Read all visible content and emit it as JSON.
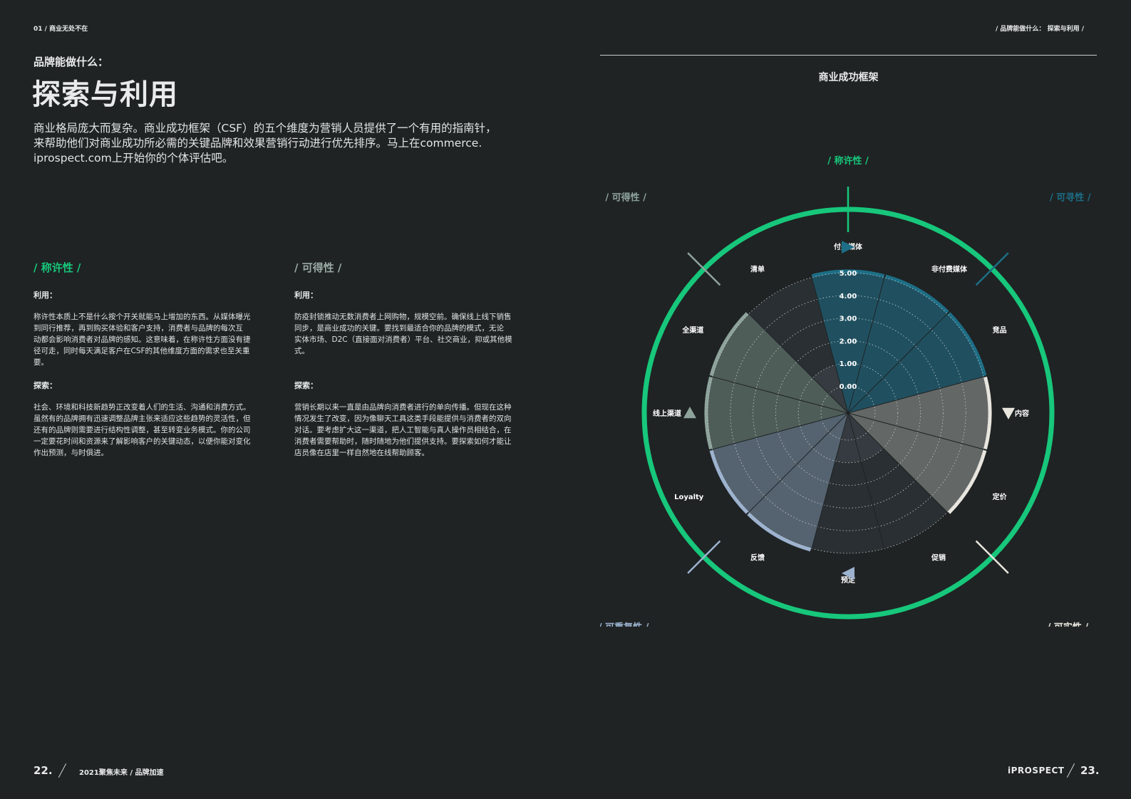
{
  "header": {
    "left": "01 / 商业无处不在",
    "right": "/ 品牌能做什么： 探索与利用 /"
  },
  "title": {
    "kicker": "品牌能做什么：",
    "main": "探索与利用"
  },
  "intro": {
    "line1": "商业格局庞大而复杂。商业成功框架（CSF）的五个维度为营销人员提供了一个有用的指南针，",
    "line2": "来帮助他们对商业成功所必需的关键品牌和效果营销行动进行优先排序。马上在commerce.",
    "line3": "iprospect.com上开始你的个体评估吧。"
  },
  "columns": [
    {
      "heading": "/ 称许性 /",
      "heading_color": "#17c77b",
      "use_label": "利用：",
      "use_lines": [
        "称许性本质上不是什么按个开关就能马上增加的东西。从媒体曝光",
        "到同行推荐，再到购买体验和客户支持，消费者与品牌的每次互",
        "动都会影响消费者对品牌的感知。这意味着，在称许性方面没有捷",
        "径可走，同时每天满足客户在CSF的其他维度方面的需求也至关重",
        "要。"
      ],
      "explore_label": "探索：",
      "explore_lines": [
        "社会、环境和科技新趋势正改变着人们的生活、沟通和消费方式。",
        "虽然有的品牌拥有迅速调整品牌主张来适应这些趋势的灵活性，但",
        "还有的品牌则需要进行结构性调整，甚至转变业务模式。你的公司",
        "一定要花时间和资源来了解影响客户的关键动态，以便你能对变化",
        "作出预测，与时俱进。"
      ]
    },
    {
      "heading": "/ 可得性 /",
      "heading_color": "#9aa9a3",
      "use_label": "利用：",
      "use_lines": [
        "防疫封锁推动无数消费者上网购物，规模空前。确保线上线下销售",
        "同步，是商业成功的关键。要找到最适合你的品牌的模式，无论",
        "实体市场、D2C（直接面对消费者）平台、社交商业，抑或其他模",
        "式。"
      ],
      "explore_label": "探索：",
      "explore_lines": [
        "营销长期以来一直是由品牌向消费者进行的单向传播。但现在这种",
        "情况发生了改变，因为像聊天工具这类手段能提供与消费者的双向",
        "对话。要考虑扩大这一渠道，把人工智能与真人操作员相结合，在",
        "消费者需要帮助时，随时随地为他们提供支持。要探索如何才能让",
        "店员像在店里一样自然地在线帮助顾客。"
      ]
    }
  ],
  "chart_data": {
    "type": "radial-bar",
    "title": "商业成功框架",
    "scale_labels": [
      "0.00",
      "1.00",
      "2.00",
      "3.00",
      "4.00",
      "5.00"
    ],
    "rmax": 5,
    "dimensions": [
      {
        "name": "/ 称许性 /",
        "color": "#17c77b",
        "marker": "line"
      },
      {
        "name": "/ 可寻性 /",
        "color": "#1d6e86",
        "marker": "triangle-right"
      },
      {
        "name": "/ 可实性 /",
        "color": "#e9e6df",
        "marker": "triangle-down"
      },
      {
        "name": "/ 可重复性 /",
        "color": "#9cb2cf",
        "marker": "triangle-left"
      },
      {
        "name": "/ 可得性 /",
        "color": "#8ea39b",
        "marker": "triangle-up"
      }
    ],
    "categories": [
      "付费媒体",
      "非付费媒体",
      "竞品",
      "内容",
      "定价",
      "促销",
      "预定",
      "反馈",
      "Loyalty",
      "线上渠道",
      "全渠道",
      "清单"
    ],
    "values": [
      5,
      5,
      5,
      5,
      5,
      1,
      1,
      5,
      5,
      5,
      5,
      1
    ]
  },
  "footer": {
    "left_num": "22.",
    "left_text": "2021聚焦未来 / 品牌加速",
    "logo": "iPROSPECT",
    "right_num": "23."
  }
}
